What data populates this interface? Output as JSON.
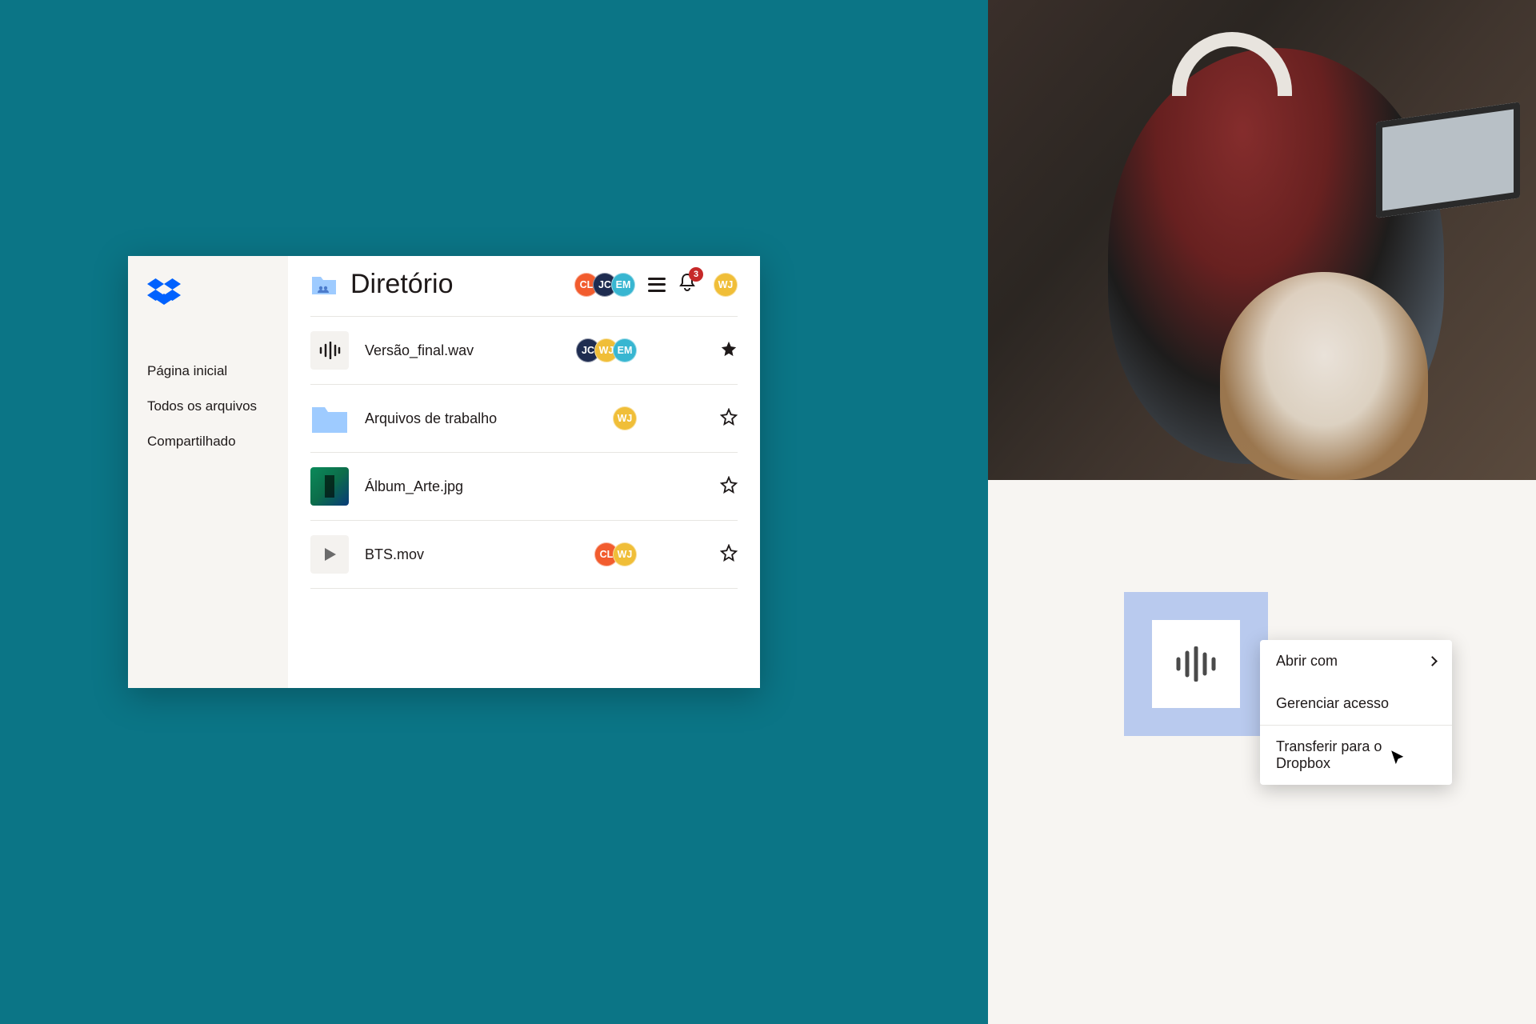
{
  "sidebar": {
    "items": [
      {
        "label": "Página inicial"
      },
      {
        "label": "Todos os arquivos"
      },
      {
        "label": "Compartilhado"
      }
    ]
  },
  "header": {
    "title": "Diretório",
    "avatars": [
      "CL",
      "JC",
      "EM"
    ],
    "notification_count": "3",
    "profile_avatar": "WJ"
  },
  "files": [
    {
      "name": "Versão_final.wav",
      "avatars": [
        "JC",
        "WJ",
        "EM"
      ],
      "starred": true,
      "type": "audio"
    },
    {
      "name": "Arquivos de trabalho",
      "avatars": [
        "WJ"
      ],
      "starred": false,
      "type": "folder"
    },
    {
      "name": "Álbum_Arte.jpg",
      "avatars": [],
      "starred": false,
      "type": "image"
    },
    {
      "name": "BTS.mov",
      "avatars": [
        "CL",
        "WJ"
      ],
      "starred": false,
      "type": "video"
    }
  ],
  "context_menu": {
    "items": [
      {
        "label": "Abrir com",
        "has_submenu": true
      },
      {
        "label": "Gerenciar acesso",
        "has_submenu": false
      },
      {
        "label": "Transferir para o Dropbox",
        "has_submenu": false
      }
    ]
  }
}
